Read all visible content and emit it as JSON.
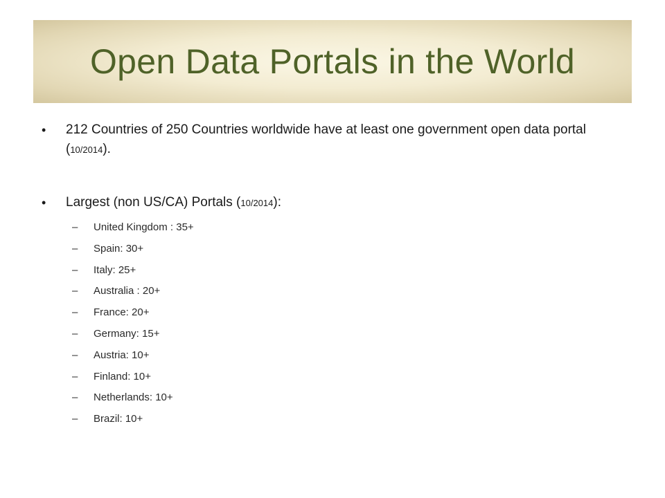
{
  "slide": {
    "title": "Open Data Portals in the World",
    "bullets": [
      {
        "marker": "•",
        "text_before": "212 Countries of 250 Countries worldwide have at least one government open data portal (",
        "date": "10/2014",
        "text_after": ")."
      },
      {
        "marker": "•",
        "text_before": "Largest (non US/CA) Portals (",
        "date": "10/2014",
        "text_after": "):"
      }
    ],
    "sub_marker": "–",
    "portals": [
      "United Kingdom : 35+",
      "Spain: 30+",
      "Italy: 25+",
      "Australia : 20+",
      "France: 20+",
      "Germany: 15+",
      "Austria: 10+",
      "Finland: 10+",
      "Netherlands: 10+",
      "Brazil: 10+"
    ]
  }
}
